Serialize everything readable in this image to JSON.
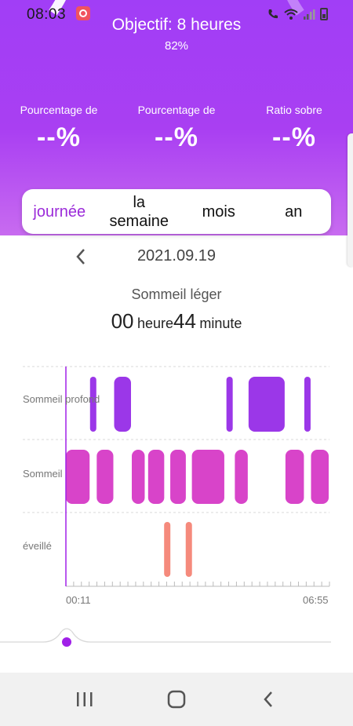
{
  "status_bar": {
    "time": "08:03"
  },
  "header": {
    "goal_title": "Objectif: 8 heures",
    "goal_percent": "82%",
    "stats": [
      {
        "label": "Pourcentage de",
        "value": "--%"
      },
      {
        "label": "Pourcentage de",
        "value": "--%"
      },
      {
        "label": "Ratio sobre",
        "value": "--%"
      }
    ]
  },
  "tabs": [
    {
      "label": "journée",
      "active": true
    },
    {
      "label": "la semaine",
      "active": false
    },
    {
      "label": "mois",
      "active": false
    },
    {
      "label": "an",
      "active": false
    }
  ],
  "date_nav": {
    "date": "2021.09.19"
  },
  "selection": {
    "label": "Sommeil léger",
    "hours": "00",
    "hours_unit": "heure",
    "minutes": "44",
    "minutes_unit": "minute"
  },
  "chart_data": {
    "type": "timeline",
    "levels": [
      "Sommeil profond",
      "Sommeil",
      "éveillé"
    ],
    "x_start_label": "00:11",
    "x_end_label": "06:55",
    "colors": {
      "deep": "#9b37e8",
      "light": "#d844c9",
      "awake": "#f58a7c",
      "cursor": "#a020e8"
    },
    "segments": [
      {
        "stage": "light",
        "start": 0.0,
        "end": 0.093
      },
      {
        "stage": "deep",
        "start": 0.093,
        "end": 0.117
      },
      {
        "stage": "light",
        "start": 0.117,
        "end": 0.183
      },
      {
        "stage": "deep",
        "start": 0.183,
        "end": 0.25
      },
      {
        "stage": "light",
        "start": 0.25,
        "end": 0.302
      },
      {
        "stage": "light",
        "start": 0.312,
        "end": 0.376
      },
      {
        "stage": "awake",
        "start": 0.376,
        "end": 0.396
      },
      {
        "stage": "light",
        "start": 0.396,
        "end": 0.458
      },
      {
        "stage": "awake",
        "start": 0.458,
        "end": 0.478
      },
      {
        "stage": "light",
        "start": 0.478,
        "end": 0.604
      },
      {
        "stage": "deep",
        "start": 0.604,
        "end": 0.641
      },
      {
        "stage": "light",
        "start": 0.641,
        "end": 0.693
      },
      {
        "stage": "deep",
        "start": 0.693,
        "end": 0.833
      },
      {
        "stage": "light",
        "start": 0.833,
        "end": 0.906
      },
      {
        "stage": "deep",
        "start": 0.906,
        "end": 0.93
      },
      {
        "stage": "light",
        "start": 0.93,
        "end": 1.0
      }
    ],
    "tick_count": 34
  },
  "slider": {
    "position": 0.19
  }
}
